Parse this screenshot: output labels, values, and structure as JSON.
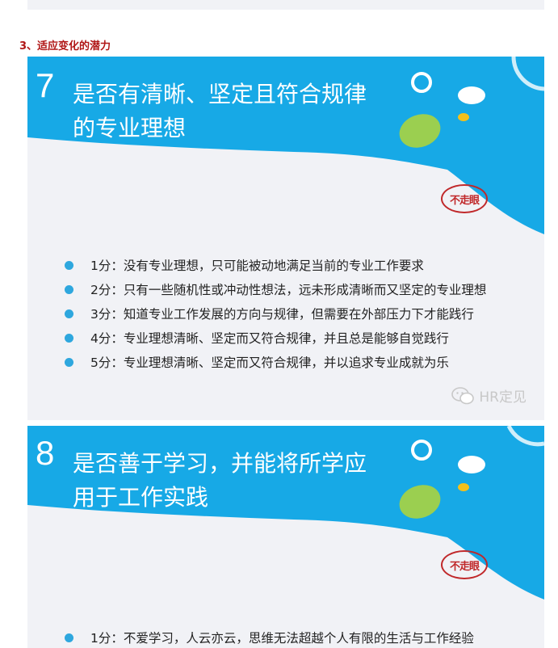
{
  "section_title": "3、适应变化的潜力",
  "slide7": {
    "number": "7",
    "title_line1": "是否有清晰、坚定且符合规律",
    "title_line2": "的专业理想",
    "logo_text": "不走眼",
    "items": [
      "1分：没有专业理想，只可能被动地满足当前的专业工作要求",
      "2分：只有一些随机性或冲动性想法，远未形成清晰而又坚定的专业理想",
      "3分：知道专业工作发展的方向与规律，但需要在外部压力下才能践行",
      "4分：专业理想清晰、坚定而又符合规律，并且总是能够自觉践行",
      "5分：专业理想清晰、坚定而又符合规律，并以追求专业成就为乐"
    ],
    "watermark": "HR定见"
  },
  "slide8": {
    "number": "8",
    "title_line1": "是否善于学习，并能将所学应",
    "title_line2": "用于工作实践",
    "logo_text": "不走眼",
    "items": [
      "1分：不爱学习，人云亦云，思维无法超越个人有限的生活与工作经验"
    ]
  },
  "colors": {
    "slide_blue": "#17a9e6",
    "slide_bg": "#f1f2f6",
    "green_blob": "#9bcf50",
    "yellow_dot": "#f4c01b",
    "section_red": "#b01616",
    "logo_red": "#c0282a"
  }
}
